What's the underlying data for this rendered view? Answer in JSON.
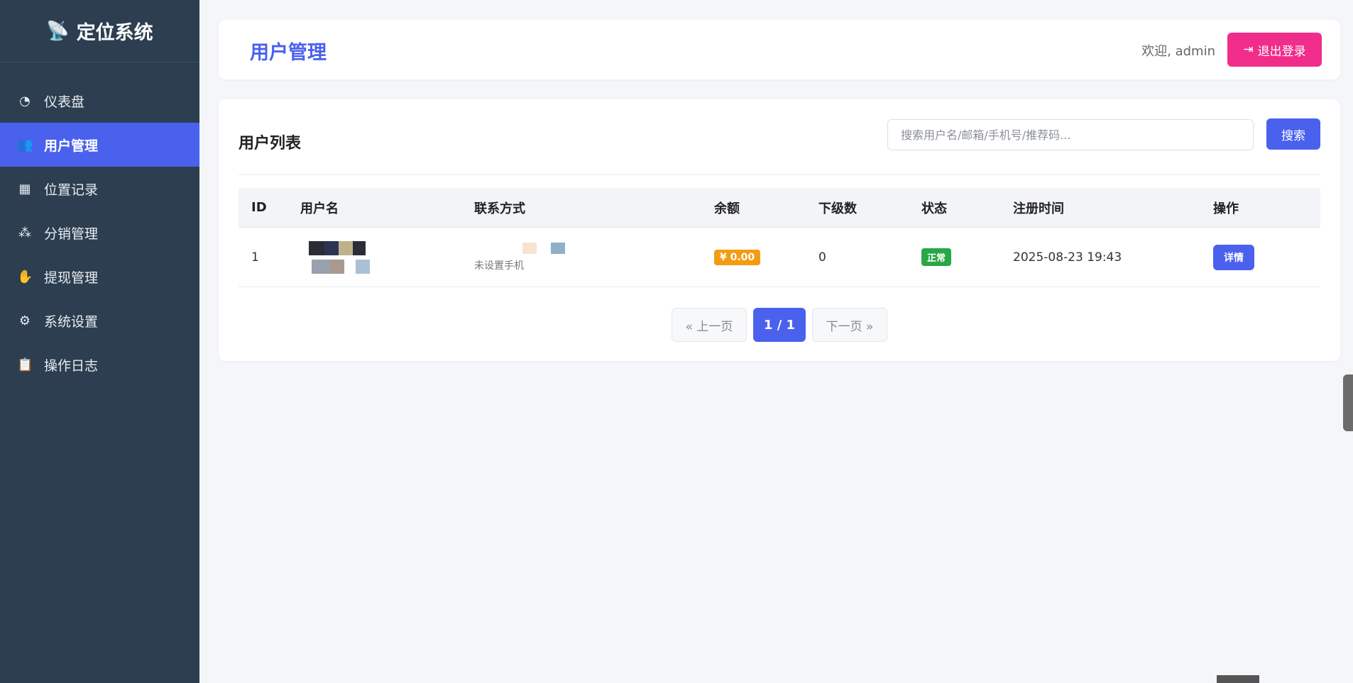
{
  "sidebar": {
    "brand": "定位系统",
    "brand_icon": "satellite-dish-icon",
    "items": [
      {
        "label": "仪表盘",
        "icon": "dashboard-icon",
        "active": false
      },
      {
        "label": "用户管理",
        "icon": "users-icon",
        "active": true
      },
      {
        "label": "位置记录",
        "icon": "map-icon",
        "active": false
      },
      {
        "label": "分销管理",
        "icon": "sitemap-icon",
        "active": false
      },
      {
        "label": "提现管理",
        "icon": "hand-coin-icon",
        "active": false
      },
      {
        "label": "系统设置",
        "icon": "gears-icon",
        "active": false
      },
      {
        "label": "操作日志",
        "icon": "clipboard-icon",
        "active": false
      }
    ]
  },
  "header": {
    "title": "用户管理",
    "welcome": "欢迎, admin",
    "logout_label": "退出登录"
  },
  "list": {
    "title": "用户列表",
    "search_placeholder": "搜索用户名/邮箱/手机号/推荐码...",
    "search_label": "搜索",
    "columns": [
      "ID",
      "用户名",
      "联系方式",
      "余额",
      "下级数",
      "状态",
      "注册时间",
      "操作"
    ],
    "rows": [
      {
        "id": "1",
        "contact_sub": "未设置手机",
        "balance": "¥ 0.00",
        "subordinates": "0",
        "status": "正常",
        "registered": "2025-08-23 19:43",
        "action": "详情"
      }
    ]
  },
  "pagination": {
    "prev": "« 上一页",
    "current": "1 / 1",
    "next": "下一页 »"
  },
  "colors": {
    "primary": "#4a61ee",
    "sidebar_bg": "#2c3e50",
    "logout": "#f02d8a",
    "balance_badge": "#f39c12",
    "status_ok": "#28a745"
  }
}
